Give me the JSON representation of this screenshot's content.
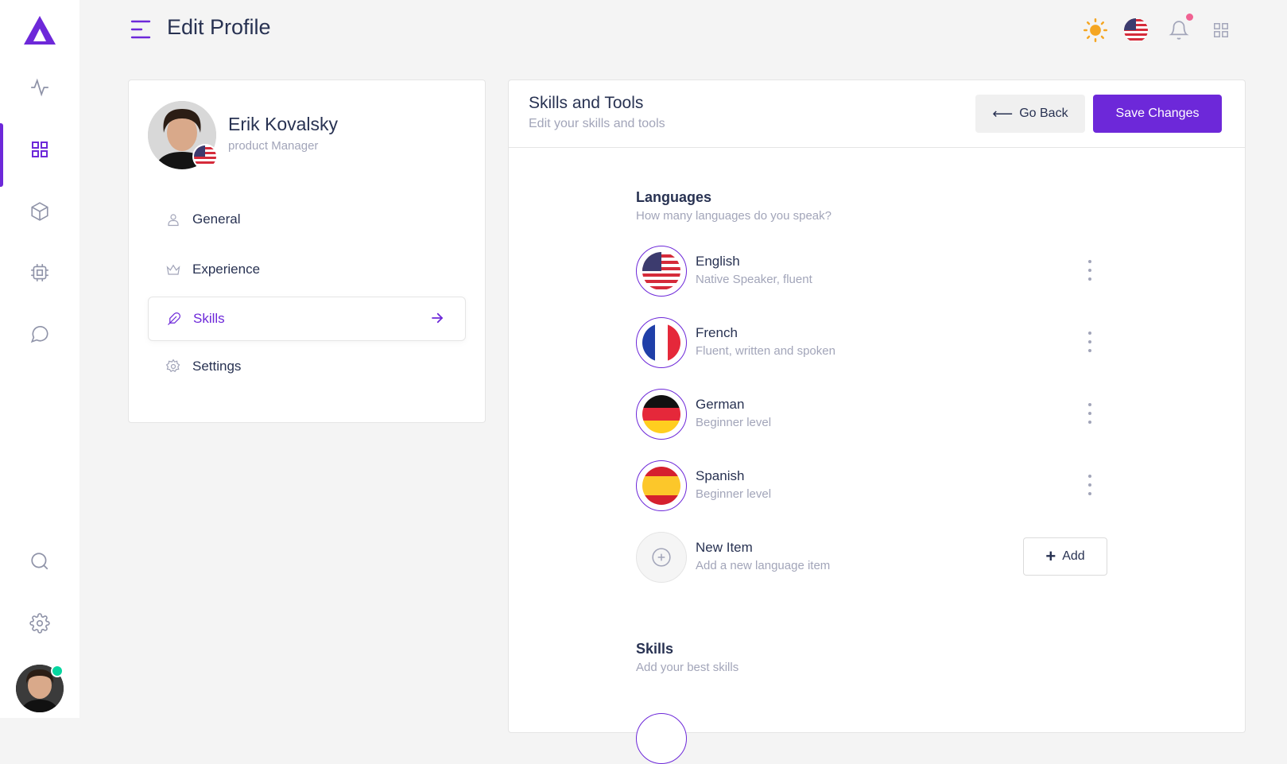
{
  "header": {
    "title": "Edit Profile"
  },
  "top_icons": [
    "sun-icon",
    "us-flag-icon",
    "bell-icon",
    "grid-icon"
  ],
  "rail": {
    "icons": [
      "activity-icon",
      "grid-icon",
      "cube-icon",
      "cpu-icon",
      "chat-icon",
      "search-icon",
      "settings-icon"
    ],
    "active": "grid-icon"
  },
  "profile": {
    "name": "Erik Kovalsky",
    "role": "product Manager"
  },
  "menu": [
    {
      "label": "General",
      "icon": "user-icon"
    },
    {
      "label": "Experience",
      "icon": "crown-icon"
    },
    {
      "label": "Skills",
      "icon": "feather-icon",
      "active": true
    },
    {
      "label": "Settings",
      "icon": "settings-icon"
    }
  ],
  "panel": {
    "title": "Skills and Tools",
    "subtitle": "Edit your skills and tools",
    "back_label": "Go Back",
    "save_label": "Save Changes"
  },
  "languages": {
    "title": "Languages",
    "subtitle": "How many languages do you speak?",
    "items": [
      {
        "name": "English",
        "desc": "Native Speaker, fluent",
        "flag": "us-flag-icon"
      },
      {
        "name": "French",
        "desc": "Fluent, written and spoken",
        "flag": "france-flag-icon"
      },
      {
        "name": "German",
        "desc": "Beginner level",
        "flag": "germany-flag-icon"
      },
      {
        "name": "Spanish",
        "desc": "Beginner level",
        "flag": "spain-flag-icon"
      }
    ],
    "new_item": {
      "name": "New Item",
      "desc": "Add a new language item",
      "add_label": "Add"
    }
  },
  "skills": {
    "title": "Skills",
    "subtitle": "Add your best skills"
  },
  "colors": {
    "accent": "#6d28d9",
    "text": "#283252",
    "muted": "#a2a5b9",
    "online": "#06d6a0",
    "notification": "#f06292"
  }
}
